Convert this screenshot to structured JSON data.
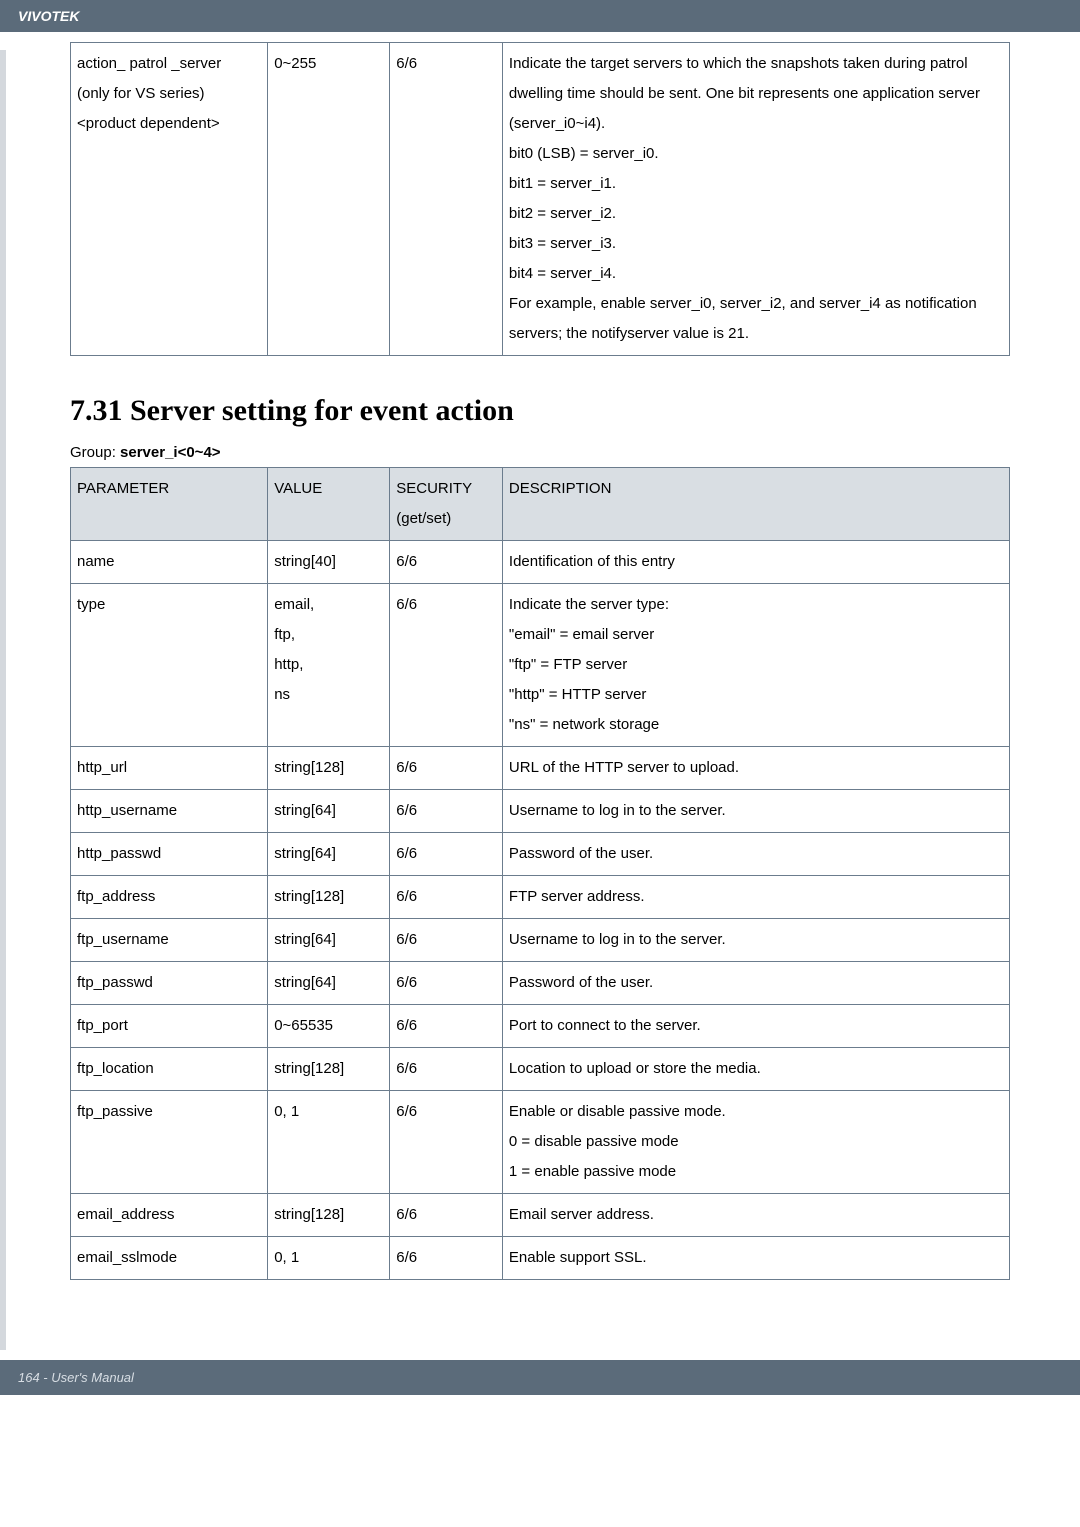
{
  "brand": "VIVOTEK",
  "footer": "164 - User's Manual",
  "table1": {
    "row": {
      "param": "action_ patrol _server\n(only for VS series)\n<product dependent>",
      "value": "0~255",
      "security": "6/6",
      "desc": "Indicate the target servers to which the snapshots taken during patrol dwelling time should be sent. One bit represents one application server (server_i0~i4).\nbit0 (LSB) = server_i0.\nbit1 = server_i1.\nbit2 = server_i2.\nbit3 = server_i3.\nbit4 = server_i4.\nFor example, enable server_i0, server_i2, and server_i4 as notification servers; the notifyserver value is 21."
    }
  },
  "section_title": "7.31 Server setting for event action",
  "group_label": "Group: ",
  "group_value": "server_i<0~4>",
  "table2": {
    "headers": {
      "param": "PARAMETER",
      "value": "VALUE",
      "security": "SECURITY\n(get/set)",
      "desc": "DESCRIPTION"
    },
    "rows": [
      {
        "param": "name",
        "value": "string[40]",
        "security": "6/6",
        "desc": "Identification of this entry"
      },
      {
        "param": "type",
        "value": "email,\nftp,\nhttp,\nns",
        "security": "6/6",
        "desc": "Indicate the server type:\n\"email\" = email server\n\"ftp\" = FTP server\n\"http\" = HTTP server\n\"ns\" = network storage"
      },
      {
        "param": "http_url",
        "value": "string[128]",
        "security": "6/6",
        "desc": "URL of the HTTP server to upload."
      },
      {
        "param": "http_username",
        "value": "string[64]",
        "security": "6/6",
        "desc": "Username to log in to the server."
      },
      {
        "param": "http_passwd",
        "value": "string[64]",
        "security": "6/6",
        "desc": "Password of the user."
      },
      {
        "param": "ftp_address",
        "value": "string[128]",
        "security": "6/6",
        "desc": "FTP server address."
      },
      {
        "param": "ftp_username",
        "value": "string[64]",
        "security": "6/6",
        "desc": "Username to log in to the server."
      },
      {
        "param": "ftp_passwd",
        "value": "string[64]",
        "security": "6/6",
        "desc": "Password of the user."
      },
      {
        "param": "ftp_port",
        "value": "0~65535",
        "security": "6/6",
        "desc": "Port to connect to the server."
      },
      {
        "param": "ftp_location",
        "value": "string[128]",
        "security": "6/6",
        "desc": "Location to upload or store the media."
      },
      {
        "param": "ftp_passive",
        "value": "0, 1",
        "security": "6/6",
        "desc": "Enable or disable passive mode.\n0 = disable passive mode\n1 = enable passive mode"
      },
      {
        "param": "email_address",
        "value": "string[128]",
        "security": "6/6",
        "desc": "Email server address."
      },
      {
        "param": "email_sslmode",
        "value": "0, 1",
        "security": "6/6",
        "desc": "Enable support SSL."
      }
    ]
  }
}
